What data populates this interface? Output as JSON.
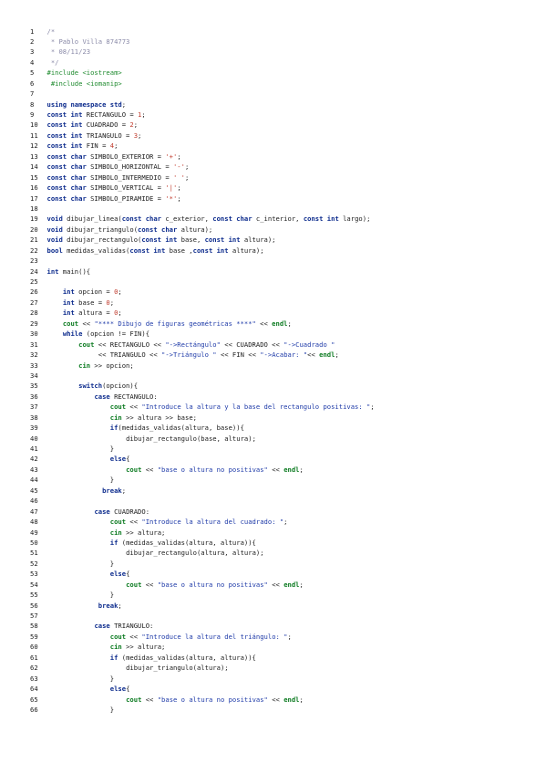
{
  "document": {
    "lines": [
      {
        "n": "1",
        "indent": 0,
        "tokens": [
          [
            "cm",
            "/*"
          ]
        ]
      },
      {
        "n": "2",
        "indent": 0,
        "tokens": [
          [
            "cm",
            " * Pablo Villa 874773"
          ]
        ]
      },
      {
        "n": "3",
        "indent": 0,
        "tokens": [
          [
            "cm",
            " * 08/11/23"
          ]
        ]
      },
      {
        "n": "4",
        "indent": 0,
        "tokens": [
          [
            "cm",
            " */"
          ]
        ]
      },
      {
        "n": "5",
        "indent": 0,
        "tokens": [
          [
            "pp",
            "#include <iostream>"
          ]
        ]
      },
      {
        "n": "6",
        "indent": 0,
        "tokens": [
          [
            "pp",
            " #include <iomanip>"
          ]
        ]
      },
      {
        "n": "7",
        "indent": 0,
        "tokens": []
      },
      {
        "n": "8",
        "indent": 0,
        "tokens": [
          [
            "kw",
            "using namespace std"
          ],
          [
            "tx",
            ";"
          ]
        ]
      },
      {
        "n": "9",
        "indent": 0,
        "tokens": [
          [
            "kw",
            "const int"
          ],
          [
            "tx",
            " RECTANGULO = "
          ],
          [
            "num",
            "1"
          ],
          [
            "tx",
            ";"
          ]
        ]
      },
      {
        "n": "10",
        "indent": 0,
        "tokens": [
          [
            "kw",
            "const int"
          ],
          [
            "tx",
            " CUADRADO = "
          ],
          [
            "num",
            "2"
          ],
          [
            "tx",
            ";"
          ]
        ]
      },
      {
        "n": "11",
        "indent": 0,
        "tokens": [
          [
            "kw",
            "const int"
          ],
          [
            "tx",
            " TRIANGULO = "
          ],
          [
            "num",
            "3"
          ],
          [
            "tx",
            ";"
          ]
        ]
      },
      {
        "n": "12",
        "indent": 0,
        "tokens": [
          [
            "kw",
            "const int"
          ],
          [
            "tx",
            " FIN = "
          ],
          [
            "num",
            "4"
          ],
          [
            "tx",
            ";"
          ]
        ]
      },
      {
        "n": "13",
        "indent": 0,
        "tokens": [
          [
            "kw",
            "const char"
          ],
          [
            "tx",
            " SIMBOLO_EXTERIOR = "
          ],
          [
            "num",
            "'+'"
          ],
          [
            "tx",
            ";"
          ]
        ]
      },
      {
        "n": "14",
        "indent": 0,
        "tokens": [
          [
            "kw",
            "const char"
          ],
          [
            "tx",
            " SIMBOLO_HORIZONTAL = "
          ],
          [
            "num",
            "'-'"
          ],
          [
            "tx",
            ";"
          ]
        ]
      },
      {
        "n": "15",
        "indent": 0,
        "tokens": [
          [
            "kw",
            "const char"
          ],
          [
            "tx",
            " SIMBOLO_INTERMEDIO = "
          ],
          [
            "num",
            "' '"
          ],
          [
            "tx",
            ";"
          ]
        ]
      },
      {
        "n": "16",
        "indent": 0,
        "tokens": [
          [
            "kw",
            "const char"
          ],
          [
            "tx",
            " SIMBOLO_VERTICAL = "
          ],
          [
            "num",
            "'|'"
          ],
          [
            "tx",
            ";"
          ]
        ]
      },
      {
        "n": "17",
        "indent": 0,
        "tokens": [
          [
            "kw",
            "const char"
          ],
          [
            "tx",
            " SIMBOLO_PIRAMIDE = "
          ],
          [
            "num",
            "'*'"
          ],
          [
            "tx",
            ";"
          ]
        ]
      },
      {
        "n": "18",
        "indent": 0,
        "tokens": []
      },
      {
        "n": "19",
        "indent": 0,
        "tokens": [
          [
            "kw",
            "void"
          ],
          [
            "tx",
            " dibujar_linea("
          ],
          [
            "kw",
            "const char"
          ],
          [
            "tx",
            " c_exterior, "
          ],
          [
            "kw",
            "const char"
          ],
          [
            "tx",
            " c_interior, "
          ],
          [
            "kw",
            "const int"
          ],
          [
            "tx",
            " largo);"
          ]
        ]
      },
      {
        "n": "20",
        "indent": 0,
        "tokens": [
          [
            "kw",
            "void"
          ],
          [
            "tx",
            " dibujar_triangulo("
          ],
          [
            "kw",
            "const char"
          ],
          [
            "tx",
            " altura);"
          ]
        ]
      },
      {
        "n": "21",
        "indent": 0,
        "tokens": [
          [
            "kw",
            "void"
          ],
          [
            "tx",
            " dibujar_rectangulo("
          ],
          [
            "kw",
            "const int"
          ],
          [
            "tx",
            " base, "
          ],
          [
            "kw",
            "const int"
          ],
          [
            "tx",
            " altura);"
          ]
        ]
      },
      {
        "n": "22",
        "indent": 0,
        "tokens": [
          [
            "kw",
            "bool"
          ],
          [
            "tx",
            " medidas_validas("
          ],
          [
            "kw",
            "const int"
          ],
          [
            "tx",
            " base ,"
          ],
          [
            "kw",
            "const int"
          ],
          [
            "tx",
            " altura);"
          ]
        ]
      },
      {
        "n": "23",
        "indent": 0,
        "tokens": []
      },
      {
        "n": "24",
        "indent": 0,
        "tokens": [
          [
            "kw",
            "int"
          ],
          [
            "tx",
            " main(){"
          ]
        ]
      },
      {
        "n": "25",
        "indent": 0,
        "tokens": []
      },
      {
        "n": "26",
        "indent": 4,
        "tokens": [
          [
            "kw",
            "int"
          ],
          [
            "tx",
            " opcion = "
          ],
          [
            "num",
            "0"
          ],
          [
            "tx",
            ";"
          ]
        ]
      },
      {
        "n": "27",
        "indent": 4,
        "tokens": [
          [
            "kw",
            "int"
          ],
          [
            "tx",
            " base = "
          ],
          [
            "num",
            "0"
          ],
          [
            "tx",
            ";"
          ]
        ]
      },
      {
        "n": "28",
        "indent": 4,
        "tokens": [
          [
            "kw",
            "int"
          ],
          [
            "tx",
            " altura = "
          ],
          [
            "num",
            "0"
          ],
          [
            "tx",
            ";"
          ]
        ]
      },
      {
        "n": "29",
        "indent": 4,
        "tokens": [
          [
            "io",
            "cout"
          ],
          [
            "tx",
            " << "
          ],
          [
            "str",
            "\"**** Dibujo de figuras geométricas ****\""
          ],
          [
            "tx",
            " << "
          ],
          [
            "io",
            "endl"
          ],
          [
            "tx",
            ";"
          ]
        ]
      },
      {
        "n": "30",
        "indent": 4,
        "tokens": [
          [
            "kw",
            "while"
          ],
          [
            "tx",
            " (opcion != FIN){"
          ]
        ]
      },
      {
        "n": "31",
        "indent": 8,
        "tokens": [
          [
            "io",
            "cout"
          ],
          [
            "tx",
            " << RECTANGULO << "
          ],
          [
            "str",
            "\"->Rectángulo\""
          ],
          [
            "tx",
            " << CUADRADO << "
          ],
          [
            "str",
            "\"->Cuadrado \""
          ]
        ]
      },
      {
        "n": "32",
        "indent": 13,
        "tokens": [
          [
            "tx",
            "<< TRIANGULO << "
          ],
          [
            "str",
            "\"->Triángulo \""
          ],
          [
            "tx",
            " << FIN << "
          ],
          [
            "str",
            "\"->Acabar: \""
          ],
          [
            "tx",
            "<< "
          ],
          [
            "io",
            "endl"
          ],
          [
            "tx",
            ";"
          ]
        ]
      },
      {
        "n": "33",
        "indent": 8,
        "tokens": [
          [
            "io",
            "cin"
          ],
          [
            "tx",
            " >> opcion;"
          ]
        ]
      },
      {
        "n": "34",
        "indent": 0,
        "tokens": []
      },
      {
        "n": "35",
        "indent": 8,
        "tokens": [
          [
            "kw",
            "switch"
          ],
          [
            "tx",
            "(opcion){"
          ]
        ]
      },
      {
        "n": "36",
        "indent": 12,
        "tokens": [
          [
            "kw",
            "case"
          ],
          [
            "tx",
            " RECTANGULO:"
          ]
        ]
      },
      {
        "n": "37",
        "indent": 16,
        "tokens": [
          [
            "io",
            "cout"
          ],
          [
            "tx",
            " << "
          ],
          [
            "str",
            "\"Introduce la altura y la base del rectangulo positivas: \""
          ],
          [
            "tx",
            ";"
          ]
        ]
      },
      {
        "n": "38",
        "indent": 16,
        "tokens": [
          [
            "io",
            "cin"
          ],
          [
            "tx",
            " >> altura >> base;"
          ]
        ]
      },
      {
        "n": "39",
        "indent": 16,
        "tokens": [
          [
            "kw",
            "if"
          ],
          [
            "tx",
            "(medidas_validas(altura, base)){"
          ]
        ]
      },
      {
        "n": "40",
        "indent": 20,
        "tokens": [
          [
            "tx",
            "dibujar_rectangulo(base, altura);"
          ]
        ]
      },
      {
        "n": "41",
        "indent": 16,
        "tokens": [
          [
            "tx",
            "}"
          ]
        ]
      },
      {
        "n": "42",
        "indent": 16,
        "tokens": [
          [
            "kw",
            "else"
          ],
          [
            "tx",
            "{"
          ]
        ]
      },
      {
        "n": "43",
        "indent": 20,
        "tokens": [
          [
            "io",
            "cout"
          ],
          [
            "tx",
            " << "
          ],
          [
            "str",
            "\"base o altura no positivas\""
          ],
          [
            "tx",
            " << "
          ],
          [
            "io",
            "endl"
          ],
          [
            "tx",
            ";"
          ]
        ]
      },
      {
        "n": "44",
        "indent": 16,
        "tokens": [
          [
            "tx",
            "}"
          ]
        ]
      },
      {
        "n": "45",
        "indent": 14,
        "tokens": [
          [
            "kw",
            "break"
          ],
          [
            "tx",
            ";"
          ]
        ]
      },
      {
        "n": "46",
        "indent": 0,
        "tokens": []
      },
      {
        "n": "47",
        "indent": 12,
        "tokens": [
          [
            "kw",
            "case"
          ],
          [
            "tx",
            " CUADRADO:"
          ]
        ]
      },
      {
        "n": "48",
        "indent": 16,
        "tokens": [
          [
            "io",
            "cout"
          ],
          [
            "tx",
            " << "
          ],
          [
            "str",
            "\"Introduce la altura del cuadrado: \""
          ],
          [
            "tx",
            ";"
          ]
        ]
      },
      {
        "n": "49",
        "indent": 16,
        "tokens": [
          [
            "io",
            "cin"
          ],
          [
            "tx",
            " >> altura;"
          ]
        ]
      },
      {
        "n": "50",
        "indent": 16,
        "tokens": [
          [
            "kw",
            "if"
          ],
          [
            "tx",
            " (medidas_validas(altura, altura)){"
          ]
        ]
      },
      {
        "n": "51",
        "indent": 20,
        "tokens": [
          [
            "tx",
            "dibujar_rectangulo(altura, altura);"
          ]
        ]
      },
      {
        "n": "52",
        "indent": 16,
        "tokens": [
          [
            "tx",
            "}"
          ]
        ]
      },
      {
        "n": "53",
        "indent": 16,
        "tokens": [
          [
            "kw",
            "else"
          ],
          [
            "tx",
            "{"
          ]
        ]
      },
      {
        "n": "54",
        "indent": 20,
        "tokens": [
          [
            "io",
            "cout"
          ],
          [
            "tx",
            " << "
          ],
          [
            "str",
            "\"base o altura no positivas\""
          ],
          [
            "tx",
            " << "
          ],
          [
            "io",
            "endl"
          ],
          [
            "tx",
            ";"
          ]
        ]
      },
      {
        "n": "55",
        "indent": 16,
        "tokens": [
          [
            "tx",
            "}"
          ]
        ]
      },
      {
        "n": "56",
        "indent": 13,
        "tokens": [
          [
            "kw",
            "break"
          ],
          [
            "tx",
            ";"
          ]
        ]
      },
      {
        "n": "57",
        "indent": 0,
        "tokens": []
      },
      {
        "n": "58",
        "indent": 12,
        "tokens": [
          [
            "kw",
            "case"
          ],
          [
            "tx",
            " TRIANGULO:"
          ]
        ]
      },
      {
        "n": "59",
        "indent": 16,
        "tokens": [
          [
            "io",
            "cout"
          ],
          [
            "tx",
            " << "
          ],
          [
            "str",
            "\"Introduce la altura del triángulo: \""
          ],
          [
            "tx",
            ";"
          ]
        ]
      },
      {
        "n": "60",
        "indent": 16,
        "tokens": [
          [
            "io",
            "cin"
          ],
          [
            "tx",
            " >> altura;"
          ]
        ]
      },
      {
        "n": "61",
        "indent": 16,
        "tokens": [
          [
            "kw",
            "if"
          ],
          [
            "tx",
            " (medidas_validas(altura, altura)){"
          ]
        ]
      },
      {
        "n": "62",
        "indent": 20,
        "tokens": [
          [
            "tx",
            "dibujar_triangulo(altura);"
          ]
        ]
      },
      {
        "n": "63",
        "indent": 16,
        "tokens": [
          [
            "tx",
            "}"
          ]
        ]
      },
      {
        "n": "64",
        "indent": 16,
        "tokens": [
          [
            "kw",
            "else"
          ],
          [
            "tx",
            "{"
          ]
        ]
      },
      {
        "n": "65",
        "indent": 20,
        "tokens": [
          [
            "io",
            "cout"
          ],
          [
            "tx",
            " << "
          ],
          [
            "str",
            "\"base o altura no positivas\""
          ],
          [
            "tx",
            " << "
          ],
          [
            "io",
            "endl"
          ],
          [
            "tx",
            ";"
          ]
        ]
      },
      {
        "n": "66",
        "indent": 16,
        "tokens": [
          [
            "tx",
            "}"
          ]
        ]
      }
    ]
  }
}
